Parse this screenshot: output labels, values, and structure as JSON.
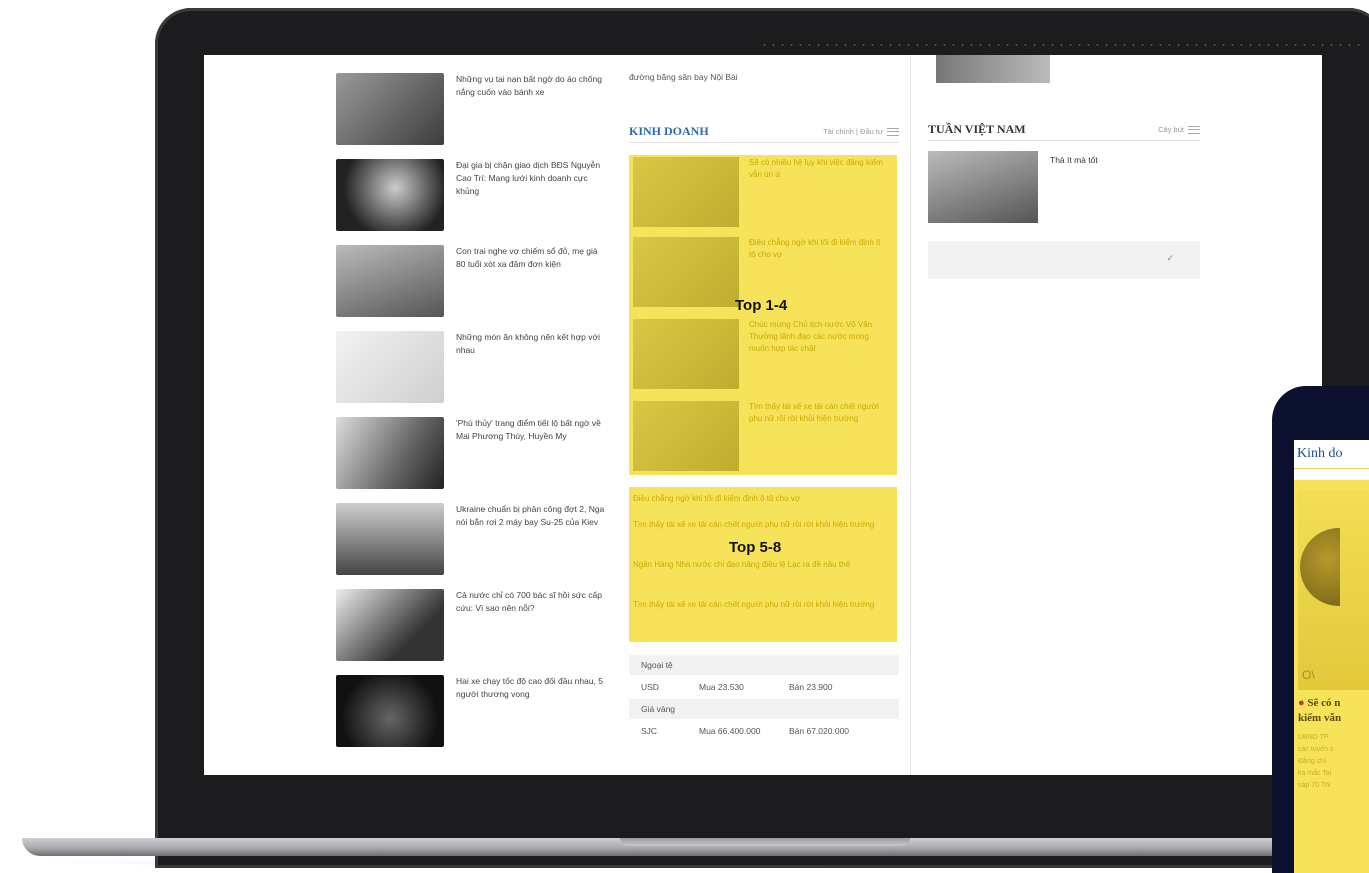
{
  "left_news": [
    {
      "text": "Những vụ tai nạn bất ngờ do áo chống nắng cuốn vào bánh xe"
    },
    {
      "text": "Đại gia bị chặn giao dịch BĐS Nguyễn Cao Trí: Mạng lưới kinh doanh cực khủng"
    },
    {
      "text": "Con trai nghe vợ chiếm sổ đỏ, mẹ già 80 tuổi xót xa đâm đơn kiện"
    },
    {
      "text": "Những món ăn không nên kết hợp với nhau"
    },
    {
      "text": "'Phù thủy' trang điểm tiết lộ bất ngờ về Mai Phương Thúy, Huyền My"
    },
    {
      "text": "Ukraine chuẩn bị phản công đợt 2, Nga nói bắn rơi 2 máy bay Su-25 của Kiev"
    },
    {
      "text": "Cả nước chỉ có 700 bác sĩ hồi sức cấp cứu: Vì sao nên nỗi?"
    },
    {
      "text": "Hai xe chạy tốc độ cao đối đầu nhau, 5 người thương vong"
    }
  ],
  "mid": {
    "top_text": "đường băng sân bay Nội Bài",
    "section_title": "KINH DOANH",
    "section_sub": "Tài chính | Đầu tư",
    "top14_label": "Top 1-4",
    "top14_items": [
      "Sẽ có nhiều hệ lụy khi việc đăng kiểm vẫn ùn ứ",
      "Điều chẳng ngờ khi tôi đi kiểm định ô tô cho vợ",
      "Chúc mừng Chủ tịch nước Võ Văn Thưởng lãnh đạo các nước mong muốn hợp tác chặt",
      "Tìm thấy tài xế xe tải cán chết người phụ nữ rồi rời khỏi hiện trường"
    ],
    "top58_label": "Top 5-8",
    "top58_items": [
      "Điều chẳng ngờ khi tôi đi kiểm định ô tô cho vợ",
      "Tìm thấy tài xế xe tải cán chết người phụ nữ rồi rời khỏi hiện trường",
      "Ngân Hàng Nhà nước chỉ đạo nâng điều lệ Lạc ra đề nâu thế",
      "Tìm thấy tài xế xe tải cán chết người phụ nữ rồi rời khỏi hiện trường"
    ],
    "rates": {
      "fx_head": "Ngoại tệ",
      "fx_row": {
        "code": "USD",
        "buy": "Mua 23.530",
        "sell": "Bán 23.900"
      },
      "gold_head": "Giá vàng",
      "gold_row": {
        "code": "SJC",
        "buy": "Mua 66.400.000",
        "sell": "Bán 67.020.000"
      }
    }
  },
  "right": {
    "section_title": "TUẦN VIỆT NAM",
    "section_sub": "Cây bút",
    "caption": "Thả ít mà tốt",
    "check": "✓"
  },
  "phone": {
    "title": "Kinh do",
    "o_glyph": "O\\",
    "headline_1": "Sẽ có n",
    "headline_2": "kiểm vẫn",
    "body_1": "UBND TP",
    "body_2": "các tuyến s",
    "body_3": "Đăng chí",
    "body_4": "ka mắc Tai",
    "body_5": "sáp 70 Thi"
  },
  "colors": {
    "highlight": "#f7e35a",
    "section_blue": "#2a6bb3",
    "laptop_frame": "#1c1c1e",
    "phone_frame": "#0d1130"
  }
}
